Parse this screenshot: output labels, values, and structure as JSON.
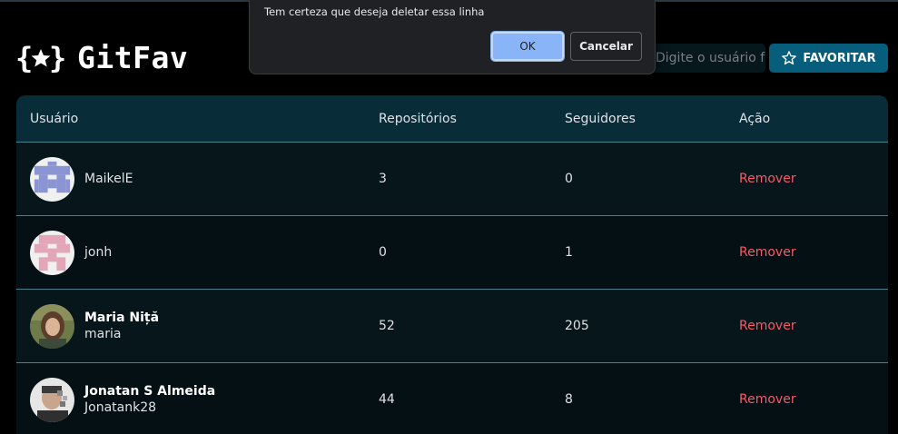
{
  "app": {
    "title": "GitFav",
    "logo_icon": "star-braces-icon"
  },
  "search": {
    "placeholder": "Digite o usuário favoritar"
  },
  "favorite_button": {
    "label": "FAVORITAR",
    "icon": "star-outline-icon"
  },
  "table": {
    "headers": {
      "user": "Usuário",
      "repos": "Repositórios",
      "followers": "Seguidores",
      "action": "Ação"
    },
    "rows": [
      {
        "name": "",
        "login": "MaikelE",
        "repos": "3",
        "followers": "0",
        "action": "Remover"
      },
      {
        "name": "",
        "login": "jonh",
        "repos": "0",
        "followers": "1",
        "action": "Remover"
      },
      {
        "name": "Maria Niță",
        "login": "maria",
        "repos": "52",
        "followers": "205",
        "action": "Remover"
      },
      {
        "name": "Jonatan S Almeida",
        "login": "Jonatank28",
        "repos": "44",
        "followers": "8",
        "action": "Remover"
      }
    ]
  },
  "dialog": {
    "message": "Tem certeza que deseja deletar essa linha",
    "ok_label": "OK",
    "cancel_label": "Cancelar"
  },
  "colors": {
    "accent": "#065e7c",
    "header_bg": "#092d38",
    "remove": "#f75a68",
    "dialog_ok": "#8ab4f8"
  }
}
